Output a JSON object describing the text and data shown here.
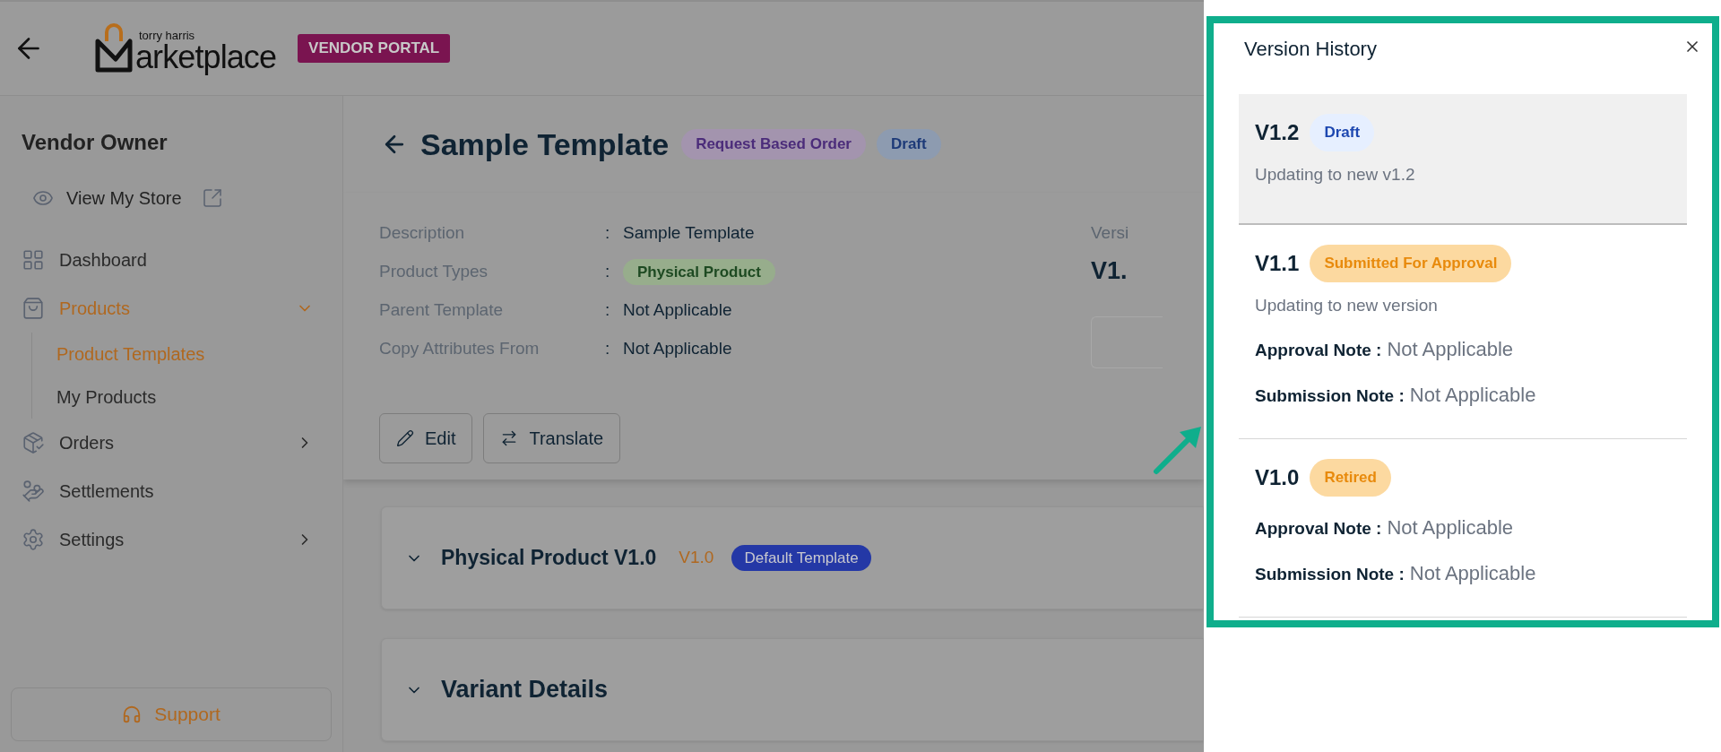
{
  "header": {
    "logo": {
      "tagline": "torry harris",
      "wordmark": "arketplace"
    },
    "badge": "VENDOR PORTAL"
  },
  "sidebar": {
    "title": "Vendor Owner",
    "view_store": "View My Store",
    "items": [
      {
        "label": "Dashboard",
        "kind": "grid",
        "selected": false
      },
      {
        "label": "Products",
        "kind": "bag",
        "selected": true,
        "expanded": true,
        "children": [
          {
            "label": "Product Templates",
            "selected": true
          },
          {
            "label": "My Products",
            "selected": false
          }
        ]
      },
      {
        "label": "Orders",
        "kind": "box",
        "selected": false,
        "expanded": false
      },
      {
        "label": "Settlements",
        "kind": "coins",
        "selected": false
      },
      {
        "label": "Settings",
        "kind": "gear",
        "selected": false,
        "expanded": false
      }
    ],
    "support": "Support"
  },
  "page": {
    "title": "Sample Template",
    "tags": [
      {
        "label": "Request Based Order",
        "kind": "order"
      },
      {
        "label": "Draft",
        "kind": "draft"
      }
    ],
    "details": [
      {
        "label": "Description",
        "separator": ":",
        "value": "Sample Template",
        "kind": "text"
      },
      {
        "label": "Product Types",
        "separator": ":",
        "value": "Physical Product",
        "kind": "tag"
      },
      {
        "label": "Parent Template",
        "separator": ":",
        "value": "Not Applicable",
        "kind": "text"
      },
      {
        "label": "Copy Attributes From",
        "separator": ":",
        "value": "Not Applicable",
        "kind": "text"
      }
    ],
    "version_label": "Versi",
    "version_value": "V1.",
    "buttons": [
      {
        "label": "Edit",
        "kind": "edit"
      },
      {
        "label": "Translate",
        "kind": "translate"
      }
    ],
    "sections": [
      {
        "title": "Physical Product V1.0",
        "version": "V1.0",
        "badge": "Default Template",
        "expanded": true
      },
      {
        "title": "Variant Details",
        "expanded": true
      }
    ]
  },
  "drawer": {
    "title": "Version History",
    "versions": [
      {
        "version": "V1.2",
        "status": "Draft",
        "kind": "draft",
        "selected": true,
        "description": "Updating to new v1.2"
      },
      {
        "version": "V1.1",
        "status": "Submitted For Approval",
        "kind": "pending",
        "selected": false,
        "description": "Updating to new version",
        "notes": [
          {
            "label": "Approval Note :",
            "value": "Not Applicable"
          },
          {
            "label": "Submission Note :",
            "value": "Not Applicable"
          }
        ]
      },
      {
        "version": "V1.0",
        "status": "Retired",
        "kind": "retired",
        "selected": false,
        "notes": [
          {
            "label": "Approval Note :",
            "value": "Not Applicable"
          },
          {
            "label": "Submission Note :",
            "value": "Not Applicable"
          }
        ]
      }
    ]
  }
}
